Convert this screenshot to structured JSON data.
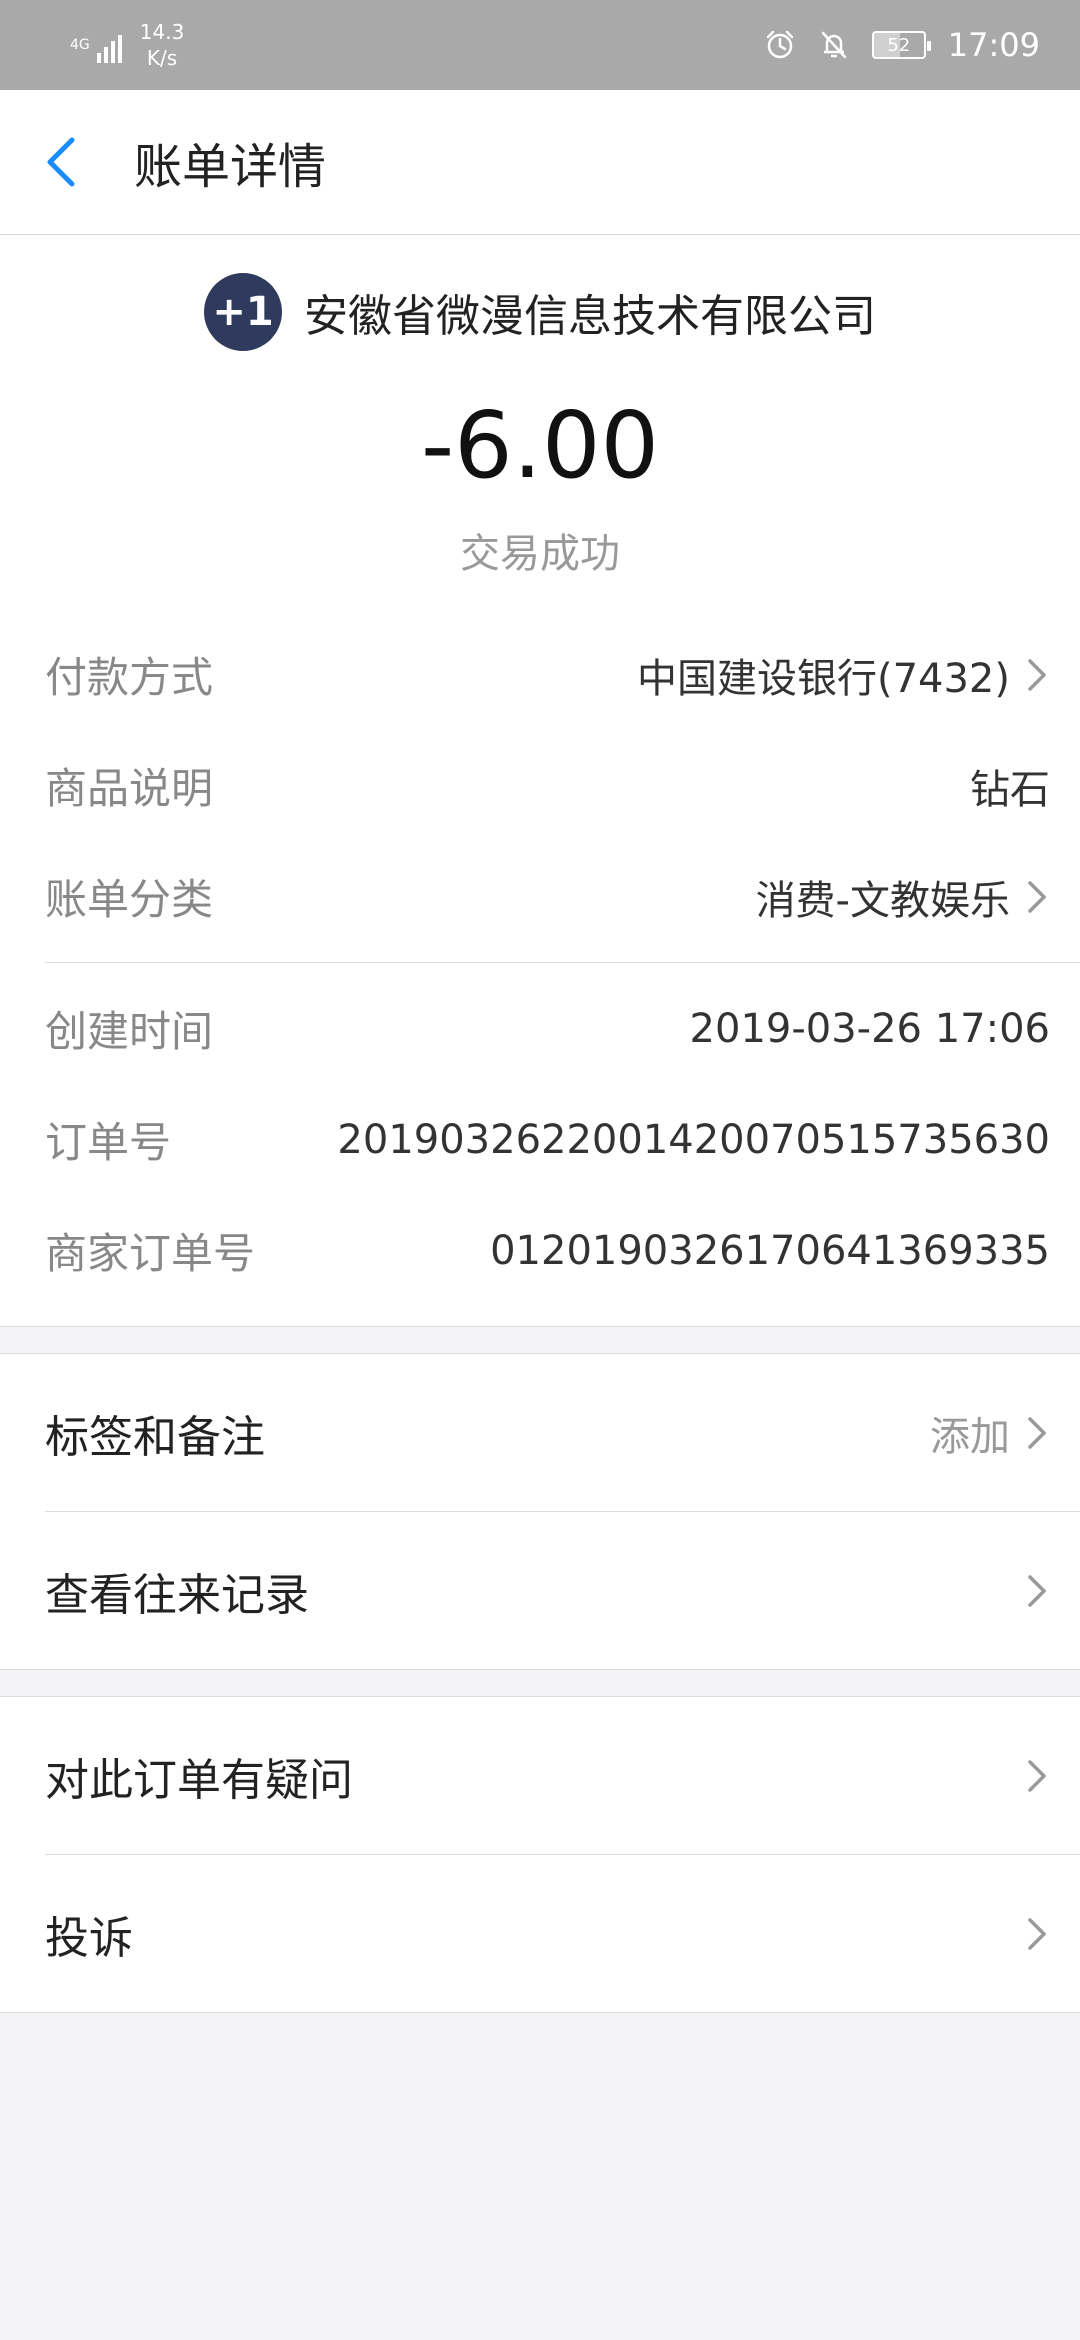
{
  "status_bar": {
    "network_type": "4G",
    "net_speed_value": "14.3",
    "net_speed_unit": "K/s",
    "battery_level": "52",
    "time": "17:09"
  },
  "nav": {
    "title": "账单详情"
  },
  "merchant": {
    "logo_text": "+1",
    "name": "安徽省微漫信息技术有限公司"
  },
  "transaction": {
    "amount": "-6.00",
    "status": "交易成功"
  },
  "details_top": [
    {
      "label": "付款方式",
      "value": "中国建设银行(7432)"
    },
    {
      "label": "商品说明",
      "value": "钻石"
    },
    {
      "label": "账单分类",
      "value": "消费-文教娱乐"
    }
  ],
  "details_bottom": [
    {
      "label": "创建时间",
      "value": "2019-03-26 17:06"
    },
    {
      "label": "订单号",
      "value": "2019032622001420070515735630"
    },
    {
      "label": "商家订单号",
      "value": "0120190326170641369335"
    }
  ],
  "menu_group_1": [
    {
      "label": "标签和备注",
      "right": "添加"
    },
    {
      "label": "查看往来记录",
      "right": ""
    }
  ],
  "menu_group_2": [
    {
      "label": "对此订单有疑问",
      "right": ""
    },
    {
      "label": "投诉",
      "right": ""
    }
  ],
  "colors": {
    "accent": "#1a8cff",
    "status_bar_bg": "#a9a9a9",
    "page_bg": "#f2f2f7"
  }
}
